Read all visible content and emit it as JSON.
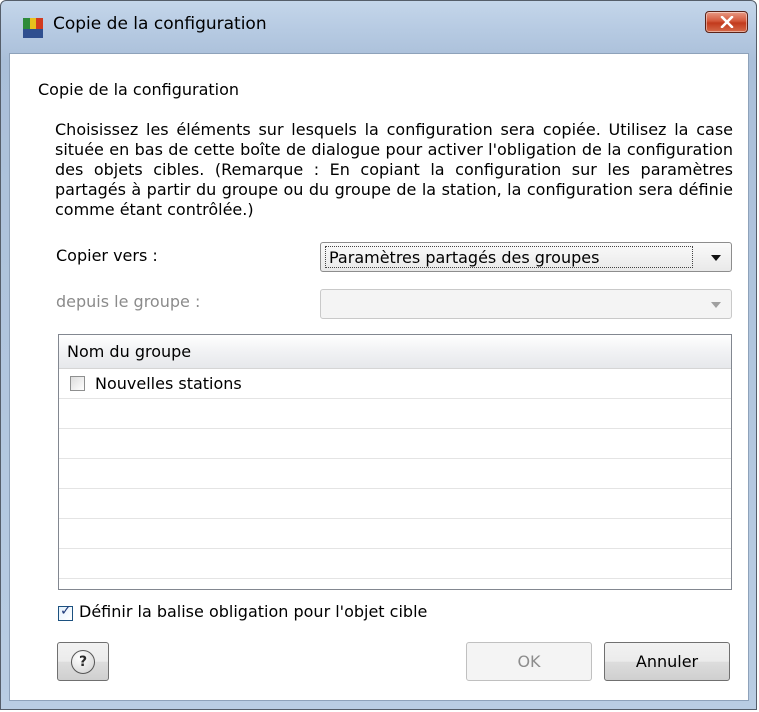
{
  "window": {
    "title": "Copie de la configuration"
  },
  "dialog": {
    "header": "Copie de la configuration",
    "description": "Choisissez les éléments sur lesquels la configuration sera copiée. Utilisez la case située en bas de cette boîte de dialogue pour activer l'obligation de la configuration des objets cibles. (Remarque : En copiant la configuration sur les paramètres partagés à partir du groupe ou du groupe de la station, la configuration sera définie comme étant contrôlée.)",
    "copy_to_label": "Copier vers :",
    "copy_to_value": "Paramètres partagés des groupes",
    "from_group_label": "depuis le groupe :",
    "from_group_value": "",
    "grid": {
      "column_header": "Nom du groupe",
      "rows": [
        {
          "label": "Nouvelles stations",
          "checked": false
        }
      ]
    },
    "obligation_checkbox": {
      "label": "Définir la balise obligation pour l'objet cible",
      "checked": true
    },
    "buttons": {
      "help": "?",
      "ok": "OK",
      "cancel": "Annuler"
    }
  },
  "icons": {
    "app": "avg-app-icon",
    "close": "close-icon",
    "help": "help-icon",
    "dropdown": "chevron-down-icon"
  },
  "colors": {
    "close_button": "#c23a1c",
    "title_bar": "#b6cae2"
  }
}
